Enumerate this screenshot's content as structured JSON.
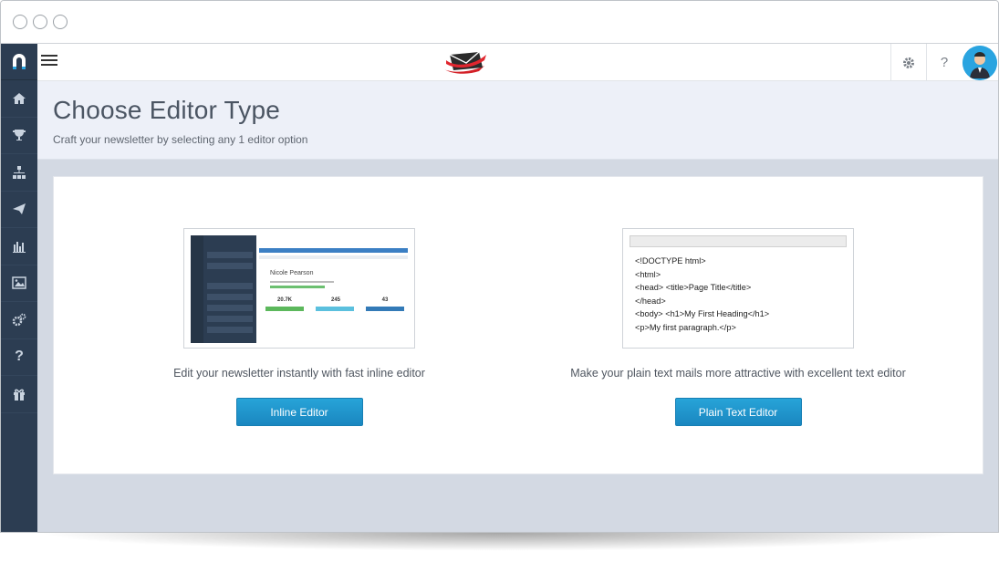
{
  "header": {
    "title": "Choose Editor Type",
    "subtitle": "Craft your newsletter by selecting any 1 editor option"
  },
  "sidebar": {
    "items": [
      {
        "icon": "home-icon"
      },
      {
        "icon": "trophy-icon"
      },
      {
        "icon": "sitemap-icon"
      },
      {
        "icon": "paper-plane-icon"
      },
      {
        "icon": "bar-chart-icon"
      },
      {
        "icon": "image-icon"
      },
      {
        "icon": "cogs-icon"
      },
      {
        "icon": "question-icon"
      },
      {
        "icon": "gift-icon"
      }
    ]
  },
  "topbar": {
    "settings_icon": "gear-icon",
    "help_label": "?"
  },
  "options": {
    "inline": {
      "description": "Edit your newsletter instantly with fast inline editor",
      "button_label": "Inline Editor",
      "preview": {
        "name": "Nicole Pearson",
        "stats": [
          "20.7K",
          "245",
          "43"
        ]
      }
    },
    "plain": {
      "description": "Make your plain text mails more attractive with excellent text editor",
      "button_label": "Plain Text Editor",
      "code": [
        "<!DOCTYPE html>",
        "<html>",
        "<head> <title>Page Title</title>",
        "</head>",
        "<body> <h1>My First Heading</h1>",
        "<p>My first paragraph.</p>"
      ]
    }
  },
  "colors": {
    "sidebar": "#2c3d52",
    "accent": "#1e95cd",
    "header_bg": "#edf0f8",
    "content_bg": "#d3d9e3"
  }
}
